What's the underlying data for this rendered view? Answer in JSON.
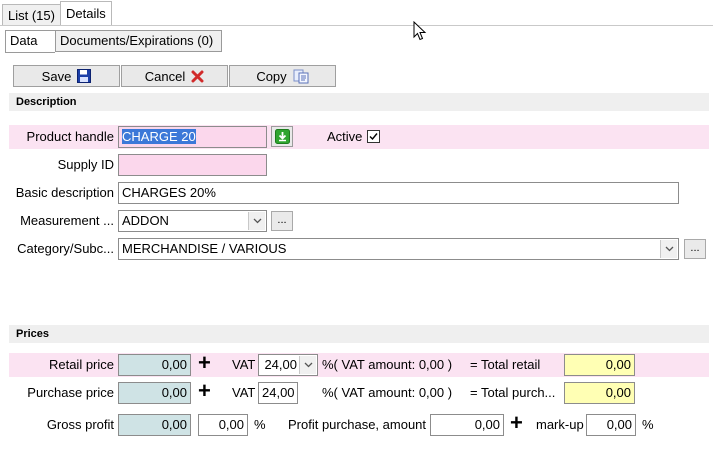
{
  "tabs": [
    {
      "label": "List (15)"
    },
    {
      "label": "Details"
    }
  ],
  "subtabs": [
    {
      "label": "Data"
    },
    {
      "label": "Documents/Expirations (0)"
    }
  ],
  "toolbar": {
    "save_label": "Save",
    "cancel_label": "Cancel",
    "copy_label": "Copy"
  },
  "sections": {
    "description": "Description",
    "prices": "Prices"
  },
  "fields": {
    "product_handle": {
      "label": "Product handle",
      "value": "CHARGE 20"
    },
    "active": {
      "label": "Active",
      "checked": true
    },
    "supply_id": {
      "label": "Supply ID",
      "value": ""
    },
    "basic_description": {
      "label": "Basic description",
      "value": "CHARGES 20%"
    },
    "measurement": {
      "label": "Measurement ...",
      "value": "ADDON"
    },
    "category": {
      "label": "Category/Subc...",
      "value": "MERCHANDISE / VARIOUS"
    },
    "ellipsis": "..."
  },
  "prices": {
    "retail_label": "Retail price",
    "retail_value": "0,00",
    "vat_label": "VAT",
    "vat_value": "24,00",
    "vat_amount_text": "%( VAT amount: 0,00 )",
    "total_retail_label": "= Total retail",
    "total_retail_value": "0,00",
    "purchase_label": "Purchase price",
    "purchase_value": "0,00",
    "vat2_value": "24,00",
    "vat_amount_text2": "%( VAT amount: 0,00 )",
    "total_purchase_label": "= Total purch...",
    "total_purchase_value": "0,00",
    "gross_profit_label": "Gross profit",
    "gross_profit_value": "0,00",
    "gross_profit_pct": "0,00",
    "percent_sign": "%",
    "profit_purchase_label": "Profit purchase, amount",
    "profit_purchase_value": "0,00",
    "markup_label": "mark-up",
    "markup_value": "0,00",
    "markup_percent_sign": "%",
    "plus": "+"
  },
  "colors": {
    "pink_band": "#fbe3f2",
    "pink_field": "#fbd7ec",
    "blue_field": "#cfe3e5",
    "yellow_field": "#ffffb4",
    "selection": "#3b78d8",
    "cancel_x": "#d12b2b",
    "save_blue": "#1c3fa8"
  }
}
